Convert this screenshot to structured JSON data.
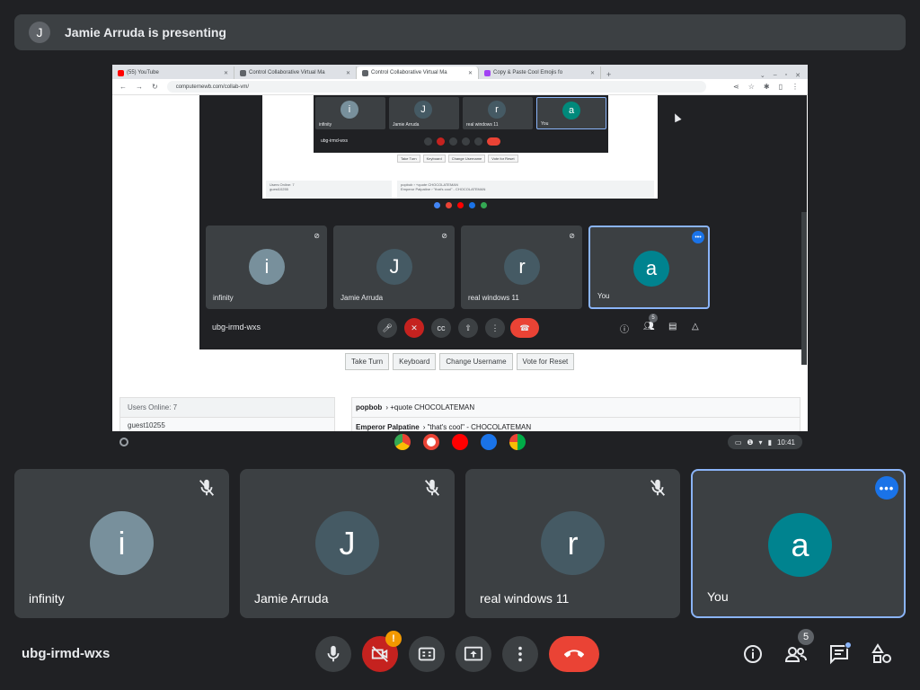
{
  "banner": {
    "avatar_letter": "J",
    "text": "Jamie Arruda is presenting"
  },
  "browser": {
    "tabs": [
      {
        "label": "(55) YouTube",
        "color": "#ff0000"
      },
      {
        "label": "Control Collaborative Virtual Ma",
        "color": "#5f6368"
      },
      {
        "label": "Control Collaborative Virtual Ma",
        "color": "#5f6368"
      },
      {
        "label": "Copy & Paste Cool Emojis fo",
        "color": "#a142f4"
      }
    ],
    "url": "computernewb.com/collab-vm/"
  },
  "vm": {
    "inner_tiles": [
      {
        "letter": "i",
        "name": "infinity",
        "color": "#78909c"
      },
      {
        "letter": "J",
        "name": "Jamie Arruda",
        "color": "#455a64"
      },
      {
        "letter": "r",
        "name": "real windows 11",
        "color": "#455a64"
      },
      {
        "letter": "a",
        "name": "You",
        "color": "#00897b"
      }
    ],
    "inner_code": "ubg-irmd-wxs",
    "inner_buttons": [
      "Take Turn",
      "Keyboard",
      "Change Username",
      "Vote for Reset"
    ],
    "inner_users": "Users Online: 7",
    "inner_user_row": "guest10255",
    "inner_chat": "popbob › +quote CHOCOLATEMAN",
    "inner_chat2": "Emperor Palpatine › \"that's cool\" - CHOCOLATEMAN",
    "tiles": [
      {
        "letter": "i",
        "name": "infinity",
        "color": "#78909c"
      },
      {
        "letter": "J",
        "name": "Jamie Arruda",
        "color": "#455a64"
      },
      {
        "letter": "r",
        "name": "real windows 11",
        "color": "#455a64"
      },
      {
        "letter": "a",
        "name": "You",
        "color": "#00838f"
      }
    ],
    "code": "ubg-irmd-wxs",
    "participant_count": "5",
    "buttons": [
      "Take Turn",
      "Keyboard",
      "Change Username",
      "Vote for Reset"
    ],
    "users_header": "Users Online: 7",
    "user_row": "guest10255",
    "chat": [
      {
        "user": "popbob",
        "msg": "›  +quote CHOCOLATEMAN"
      },
      {
        "user": "Emperor Palpatine",
        "msg": "›  \"that's cool\" - CHOCOLATEMAN"
      }
    ],
    "clock": "10:41",
    "inner_clock": "10:41"
  },
  "tiles": [
    {
      "letter": "i",
      "name": "infinity",
      "color": "#78909c"
    },
    {
      "letter": "J",
      "name": "Jamie Arruda",
      "color": "#455a64"
    },
    {
      "letter": "r",
      "name": "real windows 11",
      "color": "#455a64"
    },
    {
      "letter": "a",
      "name": "You",
      "color": "#00838f"
    }
  ],
  "meeting": {
    "code": "ubg-irmd-wxs",
    "camera_warning": "!",
    "participant_count": "5",
    "more_glyph": "•••"
  }
}
